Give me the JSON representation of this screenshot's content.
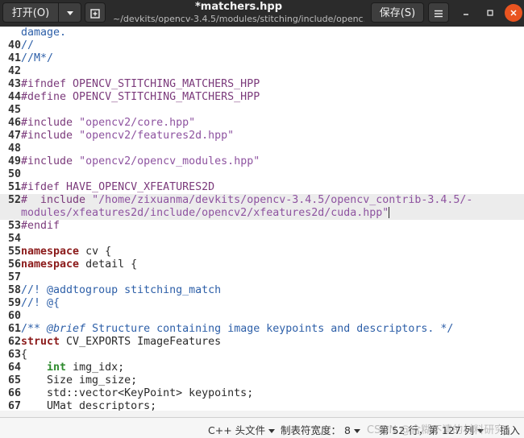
{
  "toolbar": {
    "open_label": "打开(O)",
    "save_label": "保存(S)",
    "title": "*matchers.hpp",
    "path": "~/devkits/opencv-3.4.5/modules/stitching/include/openc..."
  },
  "editor": {
    "lines": [
      {
        "num": "",
        "segs": [
          {
            "c": "cmt",
            "t": "damage."
          }
        ]
      },
      {
        "num": "40",
        "segs": [
          {
            "c": "cmt",
            "t": "//"
          }
        ]
      },
      {
        "num": "41",
        "segs": [
          {
            "c": "cmt",
            "t": "//M*/"
          }
        ]
      },
      {
        "num": "42",
        "segs": []
      },
      {
        "num": "43",
        "segs": [
          {
            "c": "pre",
            "t": "#ifndef OPENCV_STITCHING_MATCHERS_HPP"
          }
        ]
      },
      {
        "num": "44",
        "segs": [
          {
            "c": "pre",
            "t": "#define OPENCV_STITCHING_MATCHERS_HPP"
          }
        ]
      },
      {
        "num": "45",
        "segs": []
      },
      {
        "num": "46",
        "segs": [
          {
            "c": "pre",
            "t": "#include "
          },
          {
            "c": "str",
            "t": "\"opencv2/core.hpp\""
          }
        ]
      },
      {
        "num": "47",
        "segs": [
          {
            "c": "pre",
            "t": "#include "
          },
          {
            "c": "str",
            "t": "\"opencv2/features2d.hpp\""
          }
        ]
      },
      {
        "num": "48",
        "segs": []
      },
      {
        "num": "49",
        "segs": [
          {
            "c": "pre",
            "t": "#include "
          },
          {
            "c": "str",
            "t": "\"opencv2/opencv_modules.hpp\""
          }
        ]
      },
      {
        "num": "50",
        "segs": []
      },
      {
        "num": "51",
        "segs": [
          {
            "c": "pre",
            "t": "#ifdef HAVE_OPENCV_XFEATURES2D"
          }
        ]
      },
      {
        "num": "52",
        "current": true,
        "segs": [
          {
            "c": "pre",
            "t": "#  include "
          },
          {
            "c": "str",
            "t": "\"/home/zixuanma/devkits/opencv-3.4.5/opencv_contrib-3.4.5/-"
          }
        ]
      },
      {
        "num": "",
        "current": true,
        "cursor": true,
        "segs": [
          {
            "c": "str",
            "t": "modules/xfeatures2d/include/opencv2/xfeatures2d/cuda.hpp\""
          }
        ]
      },
      {
        "num": "53",
        "segs": [
          {
            "c": "pre",
            "t": "#endif"
          }
        ]
      },
      {
        "num": "54",
        "segs": []
      },
      {
        "num": "55",
        "segs": [
          {
            "c": "kw",
            "t": "namespace"
          },
          {
            "c": "code",
            "t": " cv {"
          }
        ]
      },
      {
        "num": "56",
        "segs": [
          {
            "c": "kw",
            "t": "namespace"
          },
          {
            "c": "code",
            "t": " detail {"
          }
        ]
      },
      {
        "num": "57",
        "segs": []
      },
      {
        "num": "58",
        "segs": [
          {
            "c": "cmt",
            "t": "//! @addtogroup stitching_match"
          }
        ]
      },
      {
        "num": "59",
        "segs": [
          {
            "c": "cmt",
            "t": "//! @{"
          }
        ]
      },
      {
        "num": "60",
        "segs": []
      },
      {
        "num": "61",
        "segs": [
          {
            "c": "cmt",
            "t": "/** "
          },
          {
            "c": "cmt italic",
            "t": "@brief"
          },
          {
            "c": "cmt",
            "t": " Structure containing image keypoints and descriptors. */"
          }
        ]
      },
      {
        "num": "62",
        "segs": [
          {
            "c": "kw",
            "t": "struct"
          },
          {
            "c": "code",
            "t": " CV_EXPORTS ImageFeatures"
          }
        ]
      },
      {
        "num": "63",
        "segs": [
          {
            "c": "code",
            "t": "{"
          }
        ]
      },
      {
        "num": "64",
        "segs": [
          {
            "c": "code",
            "t": "    "
          },
          {
            "c": "typ",
            "t": "int"
          },
          {
            "c": "code",
            "t": " img_idx;"
          }
        ]
      },
      {
        "num": "65",
        "segs": [
          {
            "c": "code",
            "t": "    Size img_size;"
          }
        ]
      },
      {
        "num": "66",
        "segs": [
          {
            "c": "code",
            "t": "    std::vector<KeyPoint> keypoints;"
          }
        ]
      },
      {
        "num": "67",
        "segs": [
          {
            "c": "code",
            "t": "    UMat descriptors;"
          }
        ]
      }
    ]
  },
  "status": {
    "language": "C++ 头文件",
    "tab_width": "制表符宽度： 8",
    "position": "第 52 行，第 127 列",
    "mode": "插入",
    "watermark": "CSDN @含糊不清的材料研究"
  }
}
